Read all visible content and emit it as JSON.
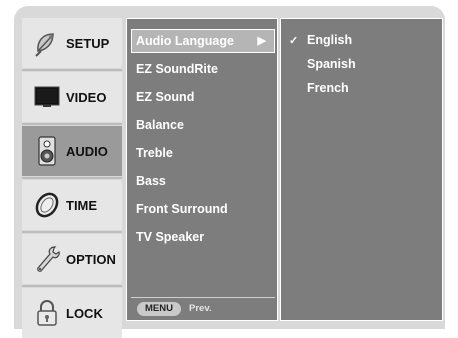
{
  "sidebar": {
    "items": [
      {
        "id": "setup",
        "label": "SETUP",
        "icon": "satellite-dish-icon",
        "active": false
      },
      {
        "id": "video",
        "label": "VIDEO",
        "icon": "monitor-icon",
        "active": false
      },
      {
        "id": "audio",
        "label": "AUDIO",
        "icon": "speaker-icon",
        "active": true
      },
      {
        "id": "time",
        "label": "TIME",
        "icon": "clock-icon",
        "active": false
      },
      {
        "id": "option",
        "label": "OPTION",
        "icon": "wrench-icon",
        "active": false
      },
      {
        "id": "lock",
        "label": "LOCK",
        "icon": "padlock-icon",
        "active": false
      }
    ]
  },
  "menu": {
    "items": [
      {
        "label": "Audio Language",
        "selected": true
      },
      {
        "label": "EZ SoundRite",
        "selected": false
      },
      {
        "label": "EZ Sound",
        "selected": false
      },
      {
        "label": "Balance",
        "selected": false
      },
      {
        "label": "Treble",
        "selected": false
      },
      {
        "label": "Bass",
        "selected": false
      },
      {
        "label": "Front Surround",
        "selected": false
      },
      {
        "label": "TV Speaker",
        "selected": false
      }
    ],
    "arrow": "▶",
    "footer": {
      "key_label": "MENU",
      "action_label": "Prev."
    }
  },
  "options": {
    "items": [
      {
        "label": "English",
        "checked": true
      },
      {
        "label": "Spanish",
        "checked": false
      },
      {
        "label": "French",
        "checked": false
      }
    ],
    "check_mark": "✓"
  },
  "colors": {
    "panel": "#7d7d7d",
    "selected_item": "#b5b5b5",
    "active_sidebar": "#9a9a9a",
    "sidebar": "#e6e6e6",
    "frame": "#d9d9d9"
  }
}
